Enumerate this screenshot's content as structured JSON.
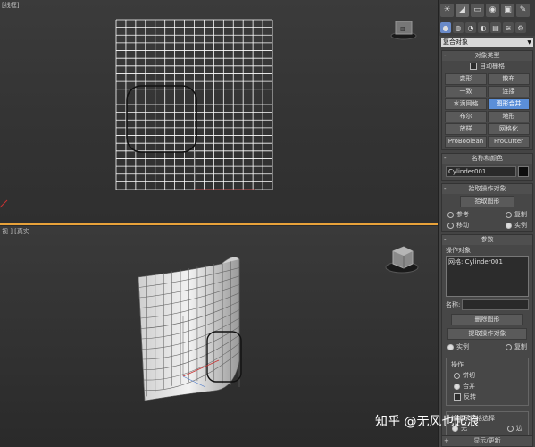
{
  "viewports": {
    "top_label": "[线框]",
    "persp_label": "视 ] [真实"
  },
  "panel": {
    "tabs": [
      "☀",
      "◢",
      "▭",
      "◉",
      "▣",
      "✎"
    ],
    "create_icons": [
      "●",
      "◍",
      "◔",
      "◐",
      "▤",
      "≋",
      "⚙"
    ],
    "category_dropdown": "复合对象",
    "object_type": {
      "title": "对象类型",
      "autogrid": "自动栅格",
      "buttons": [
        "变形",
        "散布",
        "一致",
        "连接",
        "水滴网格",
        "图形合并",
        "布尔",
        "地形",
        "放样",
        "网格化",
        "ProBoolean",
        "ProCutter"
      ],
      "active_button": "图形合并"
    },
    "name_color": {
      "title": "名称和颜色",
      "name": "Cylinder001",
      "color": "#0d0d0d"
    },
    "pick_operand": {
      "title": "拾取操作对象",
      "pick_shape": "拾取图形",
      "ref": "参考",
      "copy": "复制",
      "move": "移动",
      "instance": "实例"
    },
    "params": {
      "title": "参数",
      "operands_label": "操作对象",
      "operand_item": "网格: Cylinder001",
      "name_label": "名称:",
      "name_value": "",
      "delete_shape": "删除图形",
      "extract_operand": "提取操作对象",
      "instance": "实例",
      "copy": "复制",
      "ops_label": "操作",
      "cookie_cutter": "饼切",
      "merge": "合并",
      "invert": "反转",
      "output_label": "输出子网格选择",
      "none": "无",
      "edge": "边"
    },
    "display_update": "显示/更新"
  },
  "watermark": "知乎 @无风也起浪"
}
